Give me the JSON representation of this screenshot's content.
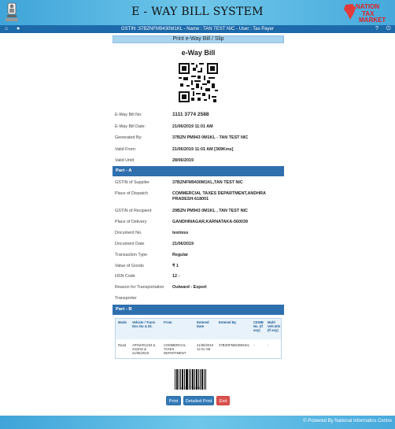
{
  "header": {
    "title": "E - WAY BILL SYSTEM",
    "brand_line1": "NATION",
    "brand_line2": "TAX",
    "brand_line3": "MARKET",
    "accent": "#1d6aaa"
  },
  "navbar": {
    "user_info": "GSTIN :37BZNFM9430M1KL - Name : TAN TEST NIC - User : Tax Payer",
    "icons": [
      "home-icon",
      "user-icon",
      "help-icon",
      "power-icon"
    ]
  },
  "slip": {
    "banner": "Print e-Way Bill / Slip",
    "title": "e-Way Bill"
  },
  "summary": [
    {
      "label": "E-Way Bill No:",
      "value": "1111 3774 2588"
    },
    {
      "label": "E-Way Bill Date:",
      "value": "21/06/2019 11:01 AM"
    },
    {
      "label": "Generated By:",
      "value": "37BZN PM943 0M1KL - TAN TEST NIC"
    },
    {
      "label": "Valid From:",
      "value": "21/06/2019 11:01 AM [369Kms]"
    },
    {
      "label": "Valid Until:",
      "value": "28/06/2019"
    }
  ],
  "part_a": {
    "heading": "Part - A",
    "rows": [
      {
        "label": "GSTIN of Supplier",
        "value": "37BZNFM9430M1KL,TAN TEST NIC"
      },
      {
        "label": "Place of Dispatch",
        "value": "COMMERCIAL TAXES DEPARTMENT,ANDHRA PRADESH-618001"
      },
      {
        "label": "GSTIN of Recipient",
        "value": "29BZN PM943 0M1KL , TAN TEST NIC"
      },
      {
        "label": "Place of Delivery",
        "value": "GANDHINAGAR,KARNATAKA-560039"
      },
      {
        "label": "Document No.",
        "value": "testmss"
      },
      {
        "label": "Document Date",
        "value": "21/06/2019"
      },
      {
        "label": "Transaction Type",
        "value": "Regular"
      },
      {
        "label": "Value of Goods",
        "value": "₹ 1"
      },
      {
        "label": "HSN Code",
        "value": "12 -"
      },
      {
        "label": "Reason for Transportation",
        "value": "Outward - Export"
      },
      {
        "label": "Transporter",
        "value": ""
      }
    ]
  },
  "part_b": {
    "heading": "Part - B",
    "columns": [
      "Mode",
      "Vehicle / Trans Doc No & Dt.",
      "From",
      "Entered Date",
      "Entered By",
      "CEWB No. (If any)",
      "Multi Veh.Info (If any)"
    ],
    "row": [
      "Road",
      "AP01KR1234 & 234234 & 21/06/2019",
      "COMMERCIAL TAXES DEPARTMENT",
      "21/06/2019 11:01 AM",
      "37BZNFM9430M1KL",
      "-",
      "-"
    ]
  },
  "barcode_number": "111137742588",
  "buttons": {
    "print": "Print",
    "detailed_print": "Detailed Print",
    "exit": "Exit"
  },
  "footer": {
    "text": "Powered By National Informatics Centre"
  }
}
